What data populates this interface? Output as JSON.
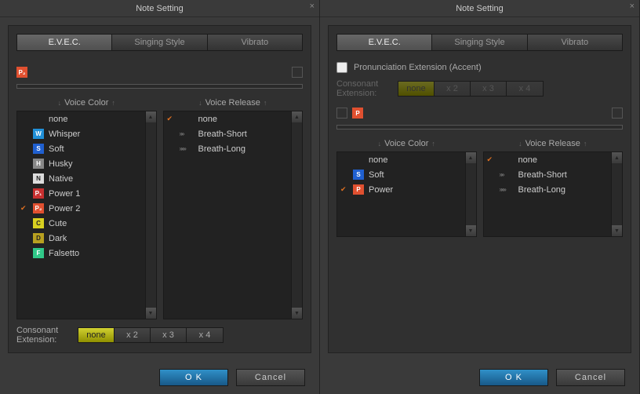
{
  "left": {
    "title": "Note Setting",
    "tabs": [
      "E.V.E.C.",
      "Singing Style",
      "Vibrato"
    ],
    "active_tab": 0,
    "mini_chip": "P₂",
    "voice_color_header": "Voice Color",
    "voice_release_header": "Voice Release",
    "voice_color": [
      {
        "name": "none",
        "chip": "",
        "bg": "",
        "checked": false
      },
      {
        "name": "Whisper",
        "chip": "W",
        "bg": "#2090d8",
        "checked": false
      },
      {
        "name": "Soft",
        "chip": "S",
        "bg": "#2060d0",
        "checked": false
      },
      {
        "name": "Husky",
        "chip": "H",
        "bg": "#888888",
        "checked": false
      },
      {
        "name": "Native",
        "chip": "N",
        "bg": "#dddddd",
        "fg": "#222",
        "checked": false
      },
      {
        "name": "Power 1",
        "chip": "P₁",
        "bg": "#c83030",
        "checked": false
      },
      {
        "name": "Power 2",
        "chip": "P₂",
        "bg": "#e05030",
        "checked": true
      },
      {
        "name": "Cute",
        "chip": "C",
        "bg": "#d8d020",
        "fg": "#222",
        "checked": false
      },
      {
        "name": "Dark",
        "chip": "D",
        "bg": "#b8a020",
        "fg": "#222",
        "checked": false
      },
      {
        "name": "Falsetto",
        "chip": "F",
        "bg": "#30c888",
        "checked": false
      }
    ],
    "voice_release": [
      {
        "name": "none",
        "checked": true,
        "arrows": 0
      },
      {
        "name": "Breath-Short",
        "checked": false,
        "arrows": 2
      },
      {
        "name": "Breath-Long",
        "checked": false,
        "arrows": 3
      }
    ],
    "ext_label1": "Consonant",
    "ext_label2": "Extension:",
    "ext_opts": [
      "none",
      "x 2",
      "x 3",
      "x 4"
    ],
    "ext_active": 0,
    "ok": "O K",
    "cancel": "Cancel"
  },
  "right": {
    "title": "Note Setting",
    "tabs": [
      "E.V.E.C.",
      "Singing Style",
      "Vibrato"
    ],
    "active_tab": 0,
    "accent_label": "Pronunciation Extension (Accent)",
    "mini_chip": "P",
    "voice_color_header": "Voice Color",
    "voice_release_header": "Voice Release",
    "voice_color": [
      {
        "name": "none",
        "chip": "",
        "bg": "",
        "checked": false
      },
      {
        "name": "Soft",
        "chip": "S",
        "bg": "#2060d0",
        "checked": false
      },
      {
        "name": "Power",
        "chip": "P",
        "bg": "#e05030",
        "checked": true
      }
    ],
    "voice_release": [
      {
        "name": "none",
        "checked": true,
        "arrows": 0
      },
      {
        "name": "Breath-Short",
        "checked": false,
        "arrows": 2
      },
      {
        "name": "Breath-Long",
        "checked": false,
        "arrows": 3
      }
    ],
    "ext_label1": "Consonant",
    "ext_label2": "Extension:",
    "ext_opts": [
      "none",
      "x 2",
      "x 3",
      "x 4"
    ],
    "ext_active": 0,
    "ok": "O K",
    "cancel": "Cancel"
  }
}
